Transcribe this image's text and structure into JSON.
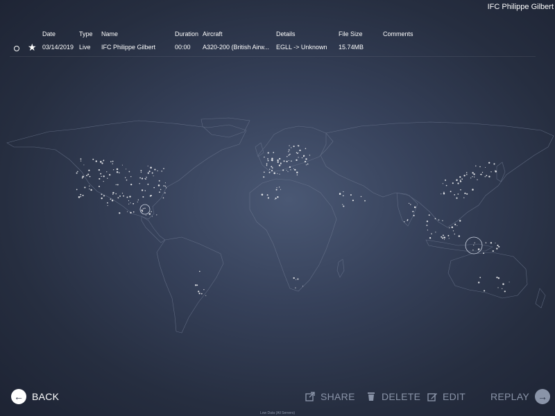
{
  "header": {
    "user_name": "IFC Philippe Gilbert"
  },
  "table": {
    "columns": [
      "Date",
      "Type",
      "Name",
      "Duration",
      "Aircraft",
      "Details",
      "File Size",
      "Comments"
    ],
    "rows": [
      {
        "date": "03/14/2019",
        "type": "Live",
        "name": "IFC Philippe Gilbert",
        "duration": "00:00",
        "aircraft": "A320-200 (British Airw...",
        "details": "EGLL -> Unknown",
        "file_size": "15.74MB",
        "comments": ""
      }
    ]
  },
  "map": {
    "type": "world-map-with-airport-dots"
  },
  "toolbar": {
    "back_label": "BACK",
    "share_label": "SHARE",
    "delete_label": "DELETE",
    "edit_label": "EDIT",
    "replay_label": "REPLAY"
  },
  "footer": {
    "note": "Low Data (All Servers)"
  },
  "colors": {
    "accent": "#ffffff",
    "disabled": "#8a94a8",
    "background": "#2a3245"
  }
}
